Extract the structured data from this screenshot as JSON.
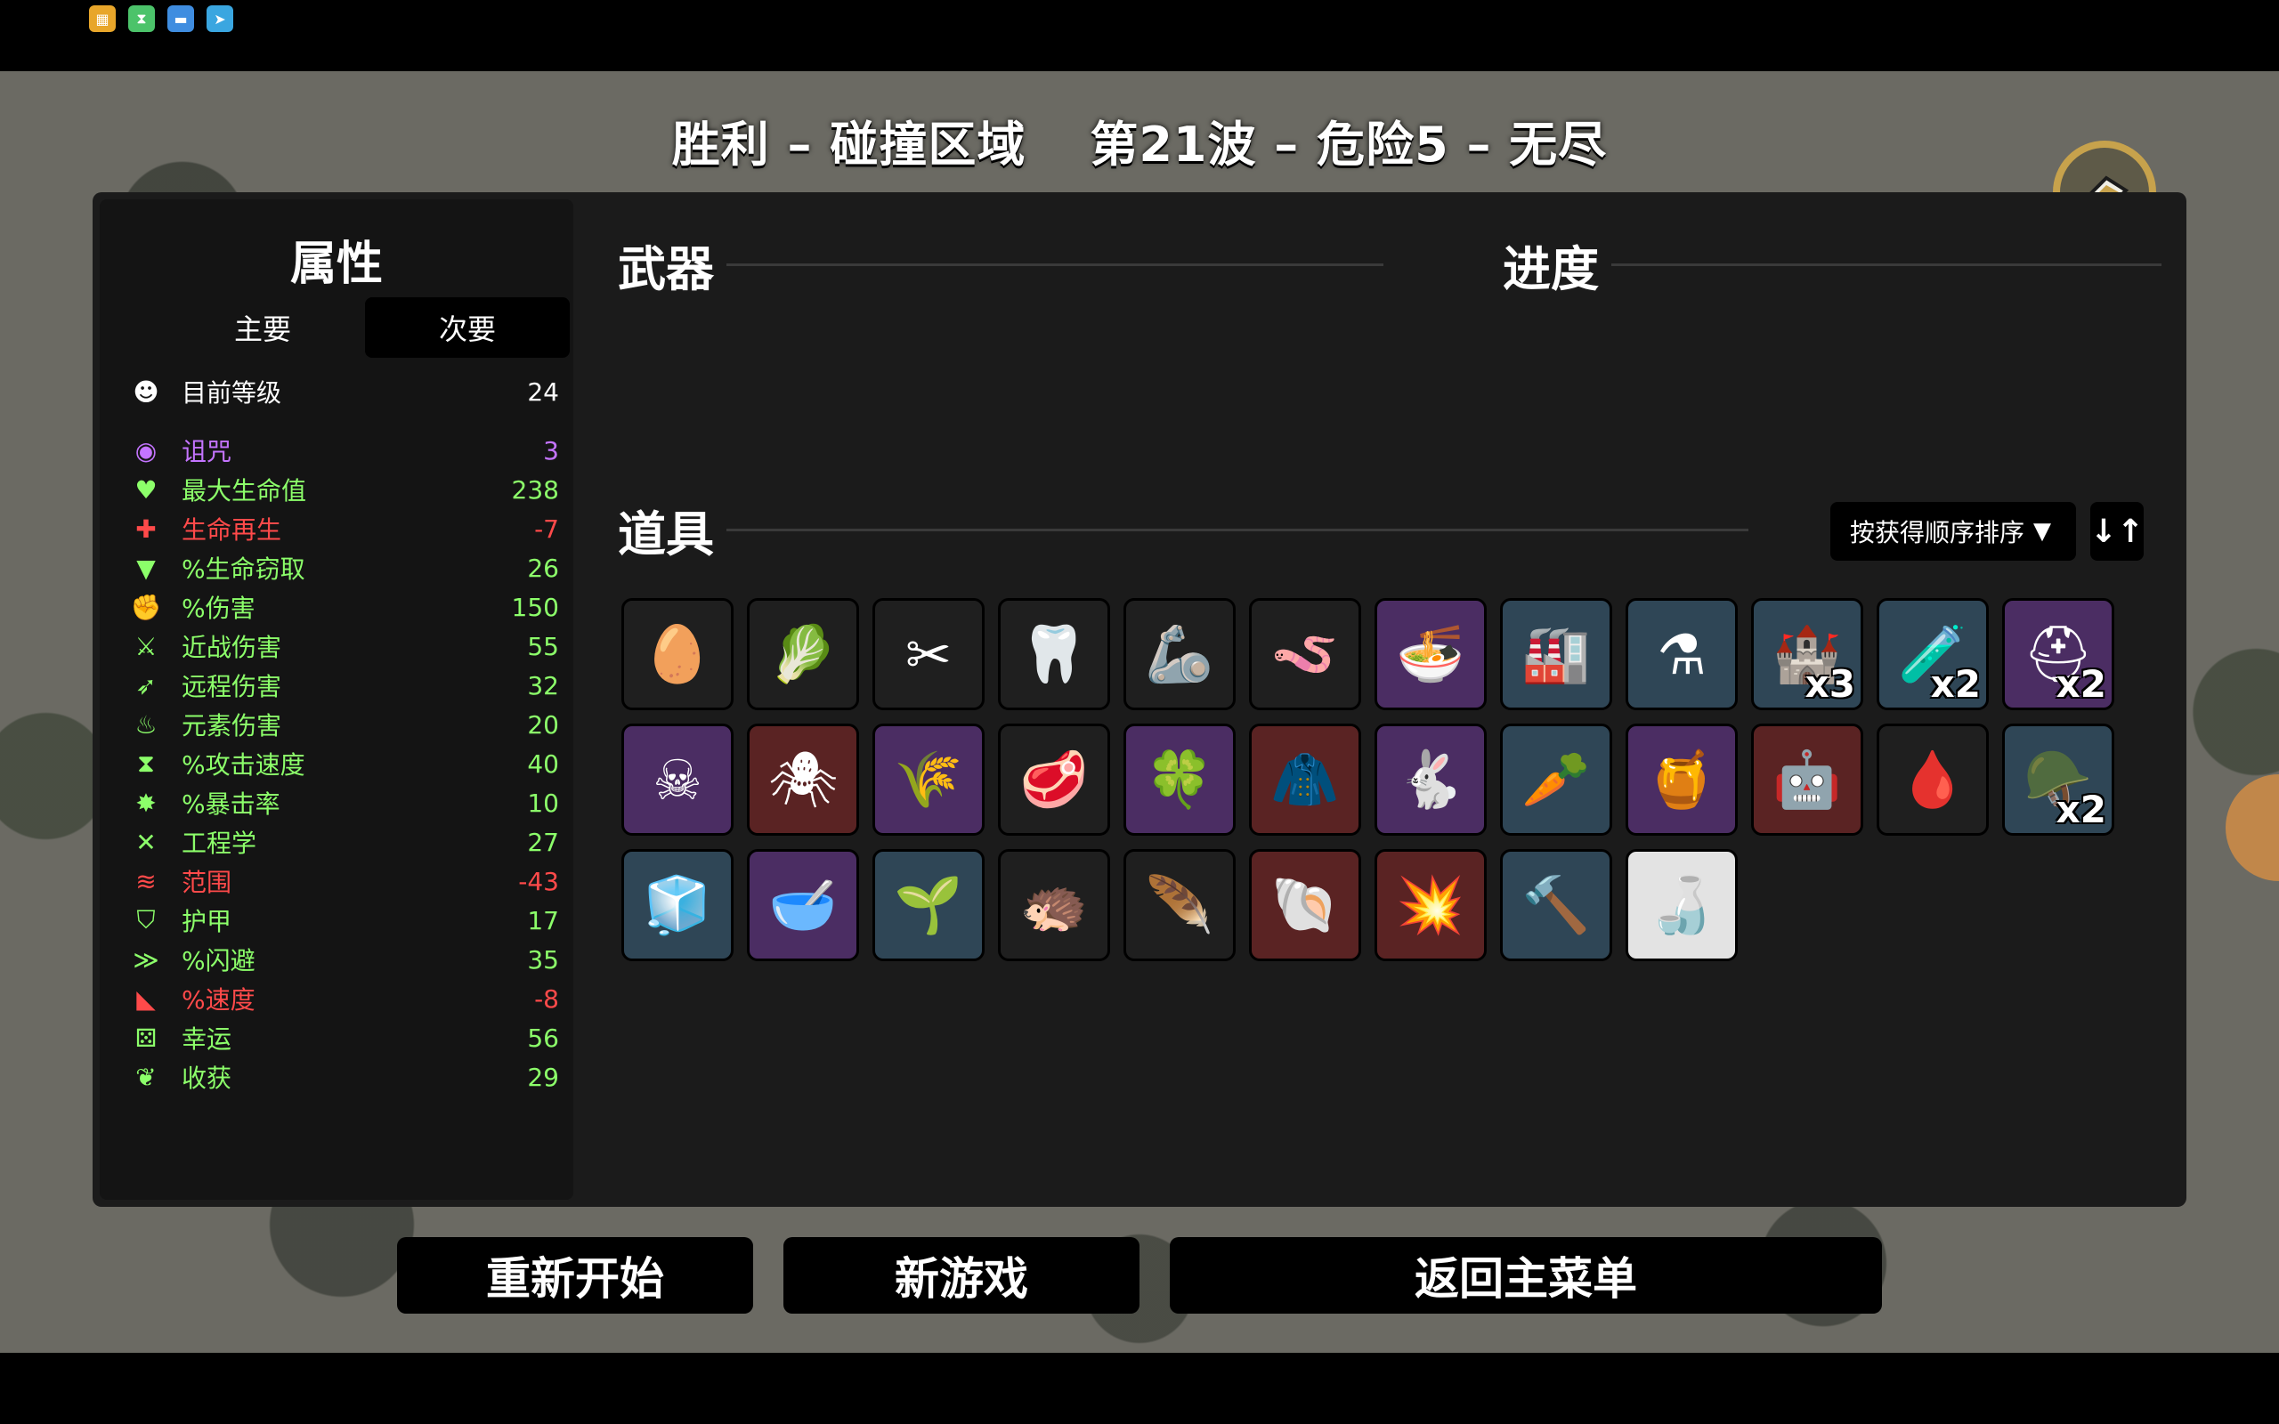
{
  "tray": [
    "app-icon-1",
    "app-icon-2",
    "app-icon-3",
    "app-icon-4"
  ],
  "title": {
    "left": "胜利 – 碰撞区域",
    "right": "第21波 – 危险5 – 无尽"
  },
  "stats": {
    "title": "属性",
    "tabs": {
      "primary": "主要",
      "secondary": "次要"
    },
    "level": {
      "label": "目前等级",
      "value": "24"
    },
    "rows": [
      {
        "label": "诅咒",
        "value": "3",
        "color": "#c474ff",
        "icon": "eye-icon"
      },
      {
        "label": "最大生命值",
        "value": "238",
        "color": "#8cff6a",
        "icon": "heart-icon"
      },
      {
        "label": "生命再生",
        "value": "-7",
        "color": "#ff4a4a",
        "icon": "regen-heart-icon"
      },
      {
        "label": "%生命窃取",
        "value": "26",
        "color": "#8cff6a",
        "icon": "fangs-icon"
      },
      {
        "label": "%伤害",
        "value": "150",
        "color": "#8cff6a",
        "icon": "muscle-icon"
      },
      {
        "label": "近战伤害",
        "value": "55",
        "color": "#8cff6a",
        "icon": "sword-icon"
      },
      {
        "label": "远程伤害",
        "value": "32",
        "color": "#8cff6a",
        "icon": "bow-icon"
      },
      {
        "label": "元素伤害",
        "value": "20",
        "color": "#8cff6a",
        "icon": "flame-icon"
      },
      {
        "label": "%攻击速度",
        "value": "40",
        "color": "#8cff6a",
        "icon": "hourglass-icon"
      },
      {
        "label": "%暴击率",
        "value": "10",
        "color": "#8cff6a",
        "icon": "crit-icon"
      },
      {
        "label": "工程学",
        "value": "27",
        "color": "#8cff6a",
        "icon": "wrench-icon"
      },
      {
        "label": "范围",
        "value": "-43",
        "color": "#ff4a4a",
        "icon": "range-icon"
      },
      {
        "label": "护甲",
        "value": "17",
        "color": "#8cff6a",
        "icon": "shield-icon"
      },
      {
        "label": "%闪避",
        "value": "35",
        "color": "#8cff6a",
        "icon": "dodge-icon"
      },
      {
        "label": "%速度",
        "value": "-8",
        "color": "#ff4a4a",
        "icon": "boot-icon"
      },
      {
        "label": "幸运",
        "value": "56",
        "color": "#8cff6a",
        "icon": "dice-icon"
      },
      {
        "label": "收获",
        "value": "29",
        "color": "#8cff6a",
        "icon": "harvest-icon"
      }
    ]
  },
  "sections": {
    "weapons": "武器",
    "progress": "进度",
    "items": "道具"
  },
  "sort": {
    "label": "按获得顺序排序"
  },
  "items": [
    {
      "name": "egg-ghost-item-icon",
      "glyph": "🥚",
      "tier": 0,
      "qty": ""
    },
    {
      "name": "sack-item-icon",
      "glyph": "🥬",
      "tier": 0,
      "qty": ""
    },
    {
      "name": "red-scar-item-icon",
      "glyph": "✂",
      "tier": 0,
      "qty": ""
    },
    {
      "name": "white-claw-item-icon",
      "glyph": "🦷",
      "tier": 0,
      "qty": ""
    },
    {
      "name": "robot-arm-item-icon",
      "glyph": "🦾",
      "tier": 0,
      "qty": ""
    },
    {
      "name": "pink-worm-item-icon",
      "glyph": "🪱",
      "tier": 0,
      "qty": ""
    },
    {
      "name": "bowl-item-icon",
      "glyph": "🍜",
      "tier": 2,
      "qty": ""
    },
    {
      "name": "factory-item-icon",
      "glyph": "🏭",
      "tier": 1,
      "qty": ""
    },
    {
      "name": "potion-flask-item-icon",
      "glyph": "⚗",
      "tier": 1,
      "qty": ""
    },
    {
      "name": "turret-item-icon",
      "glyph": "🏰",
      "tier": 1,
      "qty": "x3"
    },
    {
      "name": "green-potion-item-icon",
      "glyph": "🧪",
      "tier": 1,
      "qty": "x2"
    },
    {
      "name": "helmet-item-icon",
      "glyph": "⛑",
      "tier": 2,
      "qty": "x2"
    },
    {
      "name": "scarecrow-item-icon",
      "glyph": "☠",
      "tier": 2,
      "qty": ""
    },
    {
      "name": "spider-item-icon",
      "glyph": "🕷",
      "tier": 3,
      "qty": ""
    },
    {
      "name": "wheat-item-icon",
      "glyph": "🌾",
      "tier": 2,
      "qty": ""
    },
    {
      "name": "steak-item-icon",
      "glyph": "🥩",
      "tier": 0,
      "qty": ""
    },
    {
      "name": "clover-item-icon",
      "glyph": "🍀",
      "tier": 2,
      "qty": ""
    },
    {
      "name": "cape-item-icon",
      "glyph": "🧥",
      "tier": 3,
      "qty": ""
    },
    {
      "name": "rabbit-item-icon",
      "glyph": "🐇",
      "tier": 2,
      "qty": ""
    },
    {
      "name": "carrot-item-icon",
      "glyph": "🥕",
      "tier": 1,
      "qty": ""
    },
    {
      "name": "honey-jar-item-icon",
      "glyph": "🍯",
      "tier": 2,
      "qty": ""
    },
    {
      "name": "mech-spider-item-icon",
      "glyph": "🤖",
      "tier": 3,
      "qty": ""
    },
    {
      "name": "wounded-creature-item-icon",
      "glyph": "🩸",
      "tier": 0,
      "qty": ""
    },
    {
      "name": "knight-helm-item-icon",
      "glyph": "🪖",
      "tier": 1,
      "qty": "x2"
    },
    {
      "name": "ice-cube-item-icon",
      "glyph": "🧊",
      "tier": 1,
      "qty": ""
    },
    {
      "name": "mortar-item-icon",
      "glyph": "🥣",
      "tier": 2,
      "qty": ""
    },
    {
      "name": "garden-item-icon",
      "glyph": "🌱",
      "tier": 1,
      "qty": ""
    },
    {
      "name": "hedgehog-item-icon",
      "glyph": "🦔",
      "tier": 0,
      "qty": ""
    },
    {
      "name": "feather-item-icon",
      "glyph": "🪶",
      "tier": 0,
      "qty": ""
    },
    {
      "name": "shell-item-icon",
      "glyph": "🐚",
      "tier": 3,
      "qty": ""
    },
    {
      "name": "explosion-item-icon",
      "glyph": "💥",
      "tier": 3,
      "qty": ""
    },
    {
      "name": "shovel-item-icon",
      "glyph": "🔨",
      "tier": 1,
      "qty": ""
    },
    {
      "name": "sauce-bottle-item-icon",
      "glyph": "🍶",
      "tier": 4,
      "qty": ""
    }
  ],
  "buttons": {
    "restart": "重新开始",
    "new_game": "新游戏",
    "main_menu": "返回主菜单"
  }
}
